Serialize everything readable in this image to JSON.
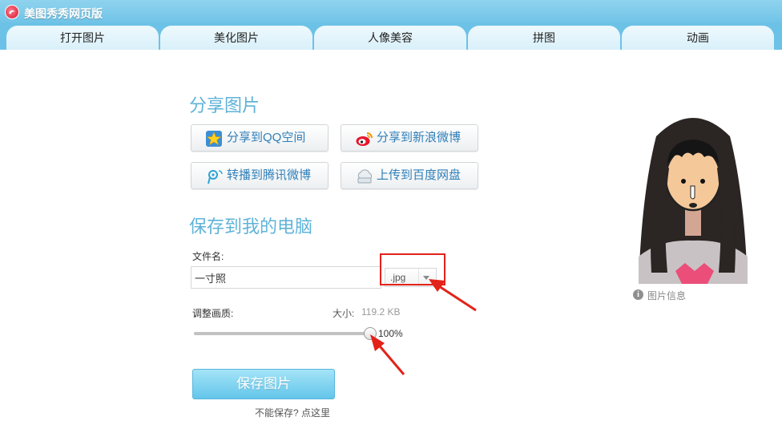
{
  "app": {
    "title": "美图秀秀网页版"
  },
  "tabs": [
    {
      "label": "打开图片"
    },
    {
      "label": "美化图片"
    },
    {
      "label": "人像美容"
    },
    {
      "label": "拼图"
    },
    {
      "label": "动画"
    }
  ],
  "share": {
    "heading": "分享图片",
    "buttons": [
      {
        "label": "分享到QQ空间",
        "icon": "qq-zone-star-icon"
      },
      {
        "label": "分享到新浪微博",
        "icon": "sina-weibo-icon"
      },
      {
        "label": "转播到腾讯微博",
        "icon": "tencent-weibo-icon"
      },
      {
        "label": "上传到百度网盘",
        "icon": "baidu-cloud-icon"
      }
    ]
  },
  "save": {
    "heading": "保存到我的电脑",
    "filename_label": "文件名:",
    "filename_value": "一寸照",
    "extension_value": "jpg",
    "quality_label": "调整画质:",
    "size_label": "大小:",
    "size_value": "119.2 KB",
    "quality_percent": "100%",
    "quality_fraction": 1.0,
    "save_button_label": "保存图片",
    "cant_save_text": "不能保存? 点这里"
  },
  "preview": {
    "info_label": "图片信息"
  },
  "colors": {
    "accent": "#6cc2e6",
    "heading": "#5fb3d9",
    "link": "#2f7fb8",
    "annotation_red": "#e2231a"
  }
}
